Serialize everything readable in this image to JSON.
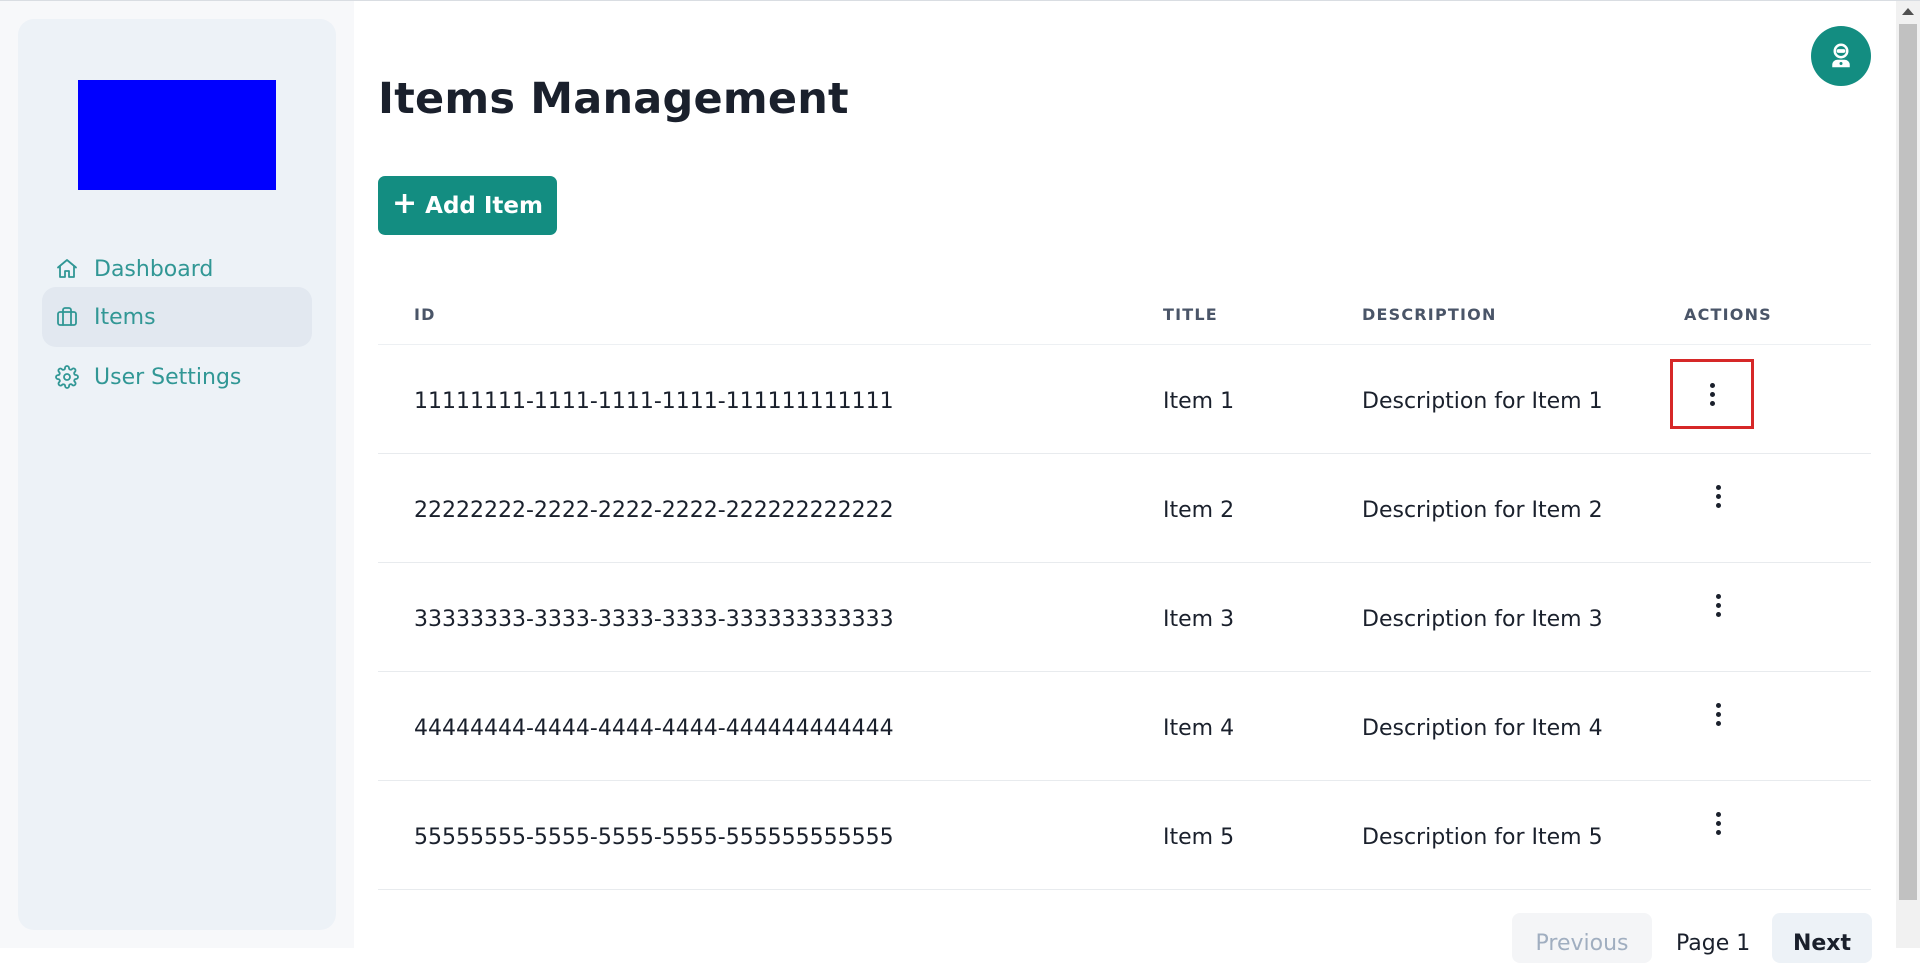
{
  "app": {
    "page_title": "Items Management",
    "add_button_label": "Add Item"
  },
  "sidebar": {
    "items": [
      {
        "label": "Dashboard",
        "icon": "home-icon",
        "active": false
      },
      {
        "label": "Items",
        "icon": "briefcase-icon",
        "active": true
      },
      {
        "label": "User Settings",
        "icon": "gear-icon",
        "active": false
      }
    ]
  },
  "table": {
    "headers": {
      "id": "ID",
      "title": "TITLE",
      "description": "DESCRIPTION",
      "actions": "ACTIONS"
    },
    "rows": [
      {
        "id": "11111111-1111-1111-1111-111111111111",
        "title": "Item 1",
        "description": "Description for Item 1"
      },
      {
        "id": "22222222-2222-2222-2222-222222222222",
        "title": "Item 2",
        "description": "Description for Item 2"
      },
      {
        "id": "33333333-3333-3333-3333-333333333333",
        "title": "Item 3",
        "description": "Description for Item 3"
      },
      {
        "id": "44444444-4444-4444-4444-444444444444",
        "title": "Item 4",
        "description": "Description for Item 4"
      },
      {
        "id": "55555555-5555-5555-5555-555555555555",
        "title": "Item 5",
        "description": "Description for Item 5"
      }
    ]
  },
  "pagination": {
    "previous_label": "Previous",
    "page_label": "Page 1",
    "next_label": "Next"
  },
  "colors": {
    "accent": "#138d81",
    "nav_text": "#319795",
    "logo": "#0000ff",
    "highlight": "#d62828"
  }
}
